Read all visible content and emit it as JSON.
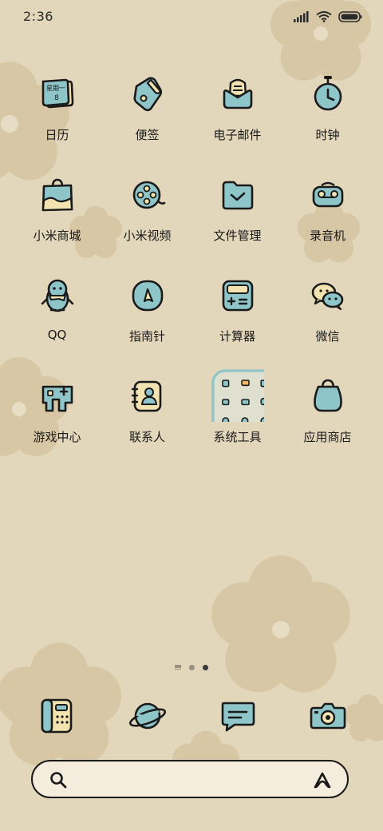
{
  "status_bar": {
    "time": "2:36",
    "icons": [
      "signal-icon",
      "wifi-icon",
      "battery-icon"
    ]
  },
  "apps": [
    {
      "label": "日历",
      "icon": "calendar-icon",
      "calendar_text_1": "星期一",
      "calendar_text_2": "8"
    },
    {
      "label": "便签",
      "icon": "notes-icon"
    },
    {
      "label": "电子邮件",
      "icon": "email-icon"
    },
    {
      "label": "时钟",
      "icon": "clock-icon"
    },
    {
      "label": "小米商城",
      "icon": "shopping-bag-icon"
    },
    {
      "label": "小米视频",
      "icon": "film-reel-icon"
    },
    {
      "label": "文件管理",
      "icon": "folder-icon"
    },
    {
      "label": "录音机",
      "icon": "recorder-icon"
    },
    {
      "label": "QQ",
      "icon": "qq-penguin-icon"
    },
    {
      "label": "指南针",
      "icon": "compass-icon"
    },
    {
      "label": "计算器",
      "icon": "calculator-icon"
    },
    {
      "label": "微信",
      "icon": "wechat-icon"
    },
    {
      "label": "游戏中心",
      "icon": "game-icon"
    },
    {
      "label": "联系人",
      "icon": "contacts-icon"
    },
    {
      "label": "系统工具",
      "icon": "folder-group-icon"
    },
    {
      "label": "应用商店",
      "icon": "app-store-bag-icon"
    }
  ],
  "page_indicator": {
    "pages": 2,
    "current": 2
  },
  "dock": [
    {
      "icon": "phone-icon"
    },
    {
      "icon": "browser-planet-icon"
    },
    {
      "icon": "messages-icon"
    },
    {
      "icon": "camera-icon"
    }
  ],
  "search_bar": {
    "icon": "search-icon",
    "assistant_icon": "assistant-icon"
  },
  "colors": {
    "background": "#e2d6bb",
    "flower": "#d6c5a0",
    "icon_blue": "#8ec5c9",
    "icon_cream": "#f3e3b0",
    "outline": "#1a1a1a"
  }
}
